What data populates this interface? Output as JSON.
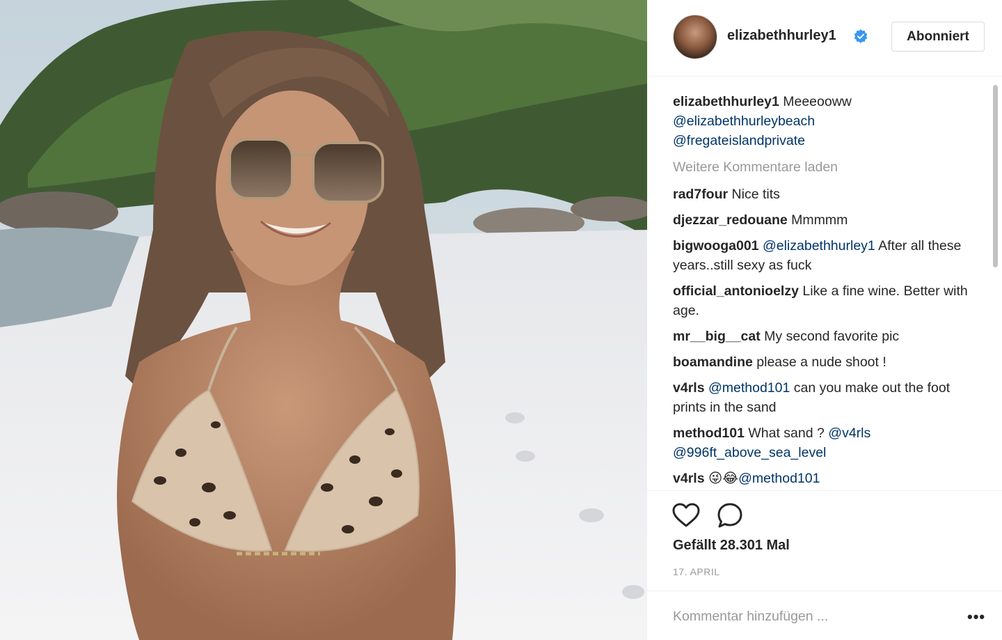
{
  "post": {
    "username": "elizabethhurley1",
    "follow_label": "Abonniert",
    "caption": {
      "user": "elizabethhurley1",
      "text": "Meeeooww",
      "mention1": "@elizabethhurleybeach",
      "mention2": "@fregateislandprivate"
    },
    "load_more": "Weitere Kommentare laden",
    "comments": [
      {
        "user": "rad7four",
        "text": "Nice tits"
      },
      {
        "user": "djezzar_redouane",
        "text": "Mmmmm"
      },
      {
        "user": "bigwooga001",
        "mention": "@elizabethhurley1",
        "text": "After all these years..still sexy as fuck"
      },
      {
        "user": "official_antonioelzy",
        "text": "Like a fine wine. Better with age."
      },
      {
        "user": "mr__big__cat",
        "text": "My second favorite pic"
      },
      {
        "user": "boamandine",
        "text": "please a nude shoot !"
      },
      {
        "user": "v4rls",
        "mention": "@method101",
        "text": "can you make out the foot prints in the sand"
      },
      {
        "user": "method101",
        "text": "What sand ?",
        "mention": "@v4rls",
        "mention2": "@996ft_above_sea_level"
      },
      {
        "user": "v4rls",
        "emoji": "😜😂",
        "mention": "@method101"
      }
    ],
    "likes": "Gefällt 28.301 Mal",
    "date": "17. APRIL",
    "add_comment_placeholder": "Kommentar hinzufügen ...",
    "more_label": "•••"
  },
  "colors": {
    "mention": "#003569",
    "muted": "#999999",
    "verified": "#3897f0"
  },
  "icons": [
    "verified-badge-icon",
    "heart-icon",
    "comment-bubble-icon",
    "more-options-icon"
  ]
}
